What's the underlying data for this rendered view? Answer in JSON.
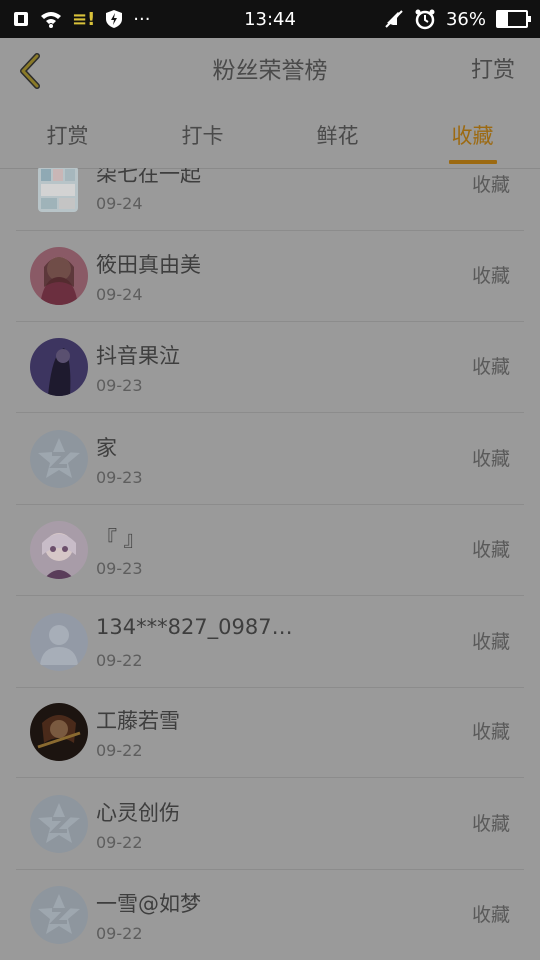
{
  "status_bar": {
    "time": "13:44",
    "battery": "36%",
    "battery_level": 0.36,
    "left_icons": [
      "sim-icon",
      "wifi-icon",
      "notification-icon",
      "shield-icon",
      "more-dots-icon"
    ],
    "warn_text": "≡!",
    "dots_text": "···",
    "right_icons": [
      "mute-icon",
      "alarm-icon",
      "battery-icon"
    ]
  },
  "header": {
    "title": "粉丝荣誉榜",
    "right_label": "打赏"
  },
  "tabs": [
    {
      "label": "打赏",
      "active": false
    },
    {
      "label": "打卡",
      "active": false
    },
    {
      "label": "鲜花",
      "active": false
    },
    {
      "label": "收藏",
      "active": true
    }
  ],
  "accent_color": "#9c6a12",
  "list": [
    {
      "name": "柒七在一起",
      "date": "09-24",
      "action": "收藏",
      "avatar": "photo-collage"
    },
    {
      "name": "筱田真由美",
      "date": "09-24",
      "action": "收藏",
      "avatar": "photo-girl"
    },
    {
      "name": "抖音果泣",
      "date": "09-23",
      "action": "收藏",
      "avatar": "photo-dark"
    },
    {
      "name": "家",
      "date": "09-23",
      "action": "收藏",
      "avatar": "default-star"
    },
    {
      "name": "『 』",
      "date": "09-23",
      "action": "收藏",
      "avatar": "photo-anime"
    },
    {
      "name": "134***827_0987…",
      "date": "09-22",
      "action": "收藏",
      "avatar": "default-person"
    },
    {
      "name": "工藤若雪",
      "date": "09-22",
      "action": "收藏",
      "avatar": "photo-violin"
    },
    {
      "name": "心灵创伤",
      "date": "09-22",
      "action": "收藏",
      "avatar": "default-star"
    },
    {
      "name": "一雪@如梦",
      "date": "09-22",
      "action": "收藏",
      "avatar": "default-star"
    }
  ]
}
